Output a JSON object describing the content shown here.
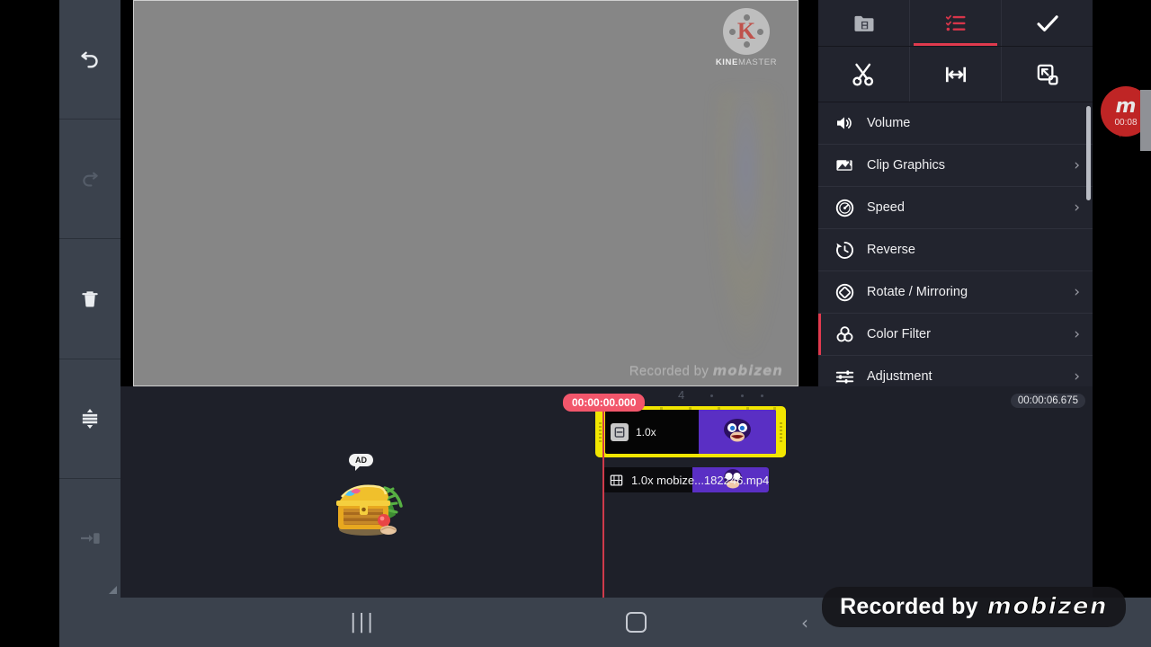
{
  "app": {
    "name": "KineMaster",
    "watermark_text_bold": "KINE",
    "watermark_text_light": "MASTER",
    "watermark_letter": "K"
  },
  "left_rail": {
    "items": [
      {
        "name": "undo",
        "icon": "undo-icon",
        "enabled": true
      },
      {
        "name": "redo",
        "icon": "redo-icon",
        "enabled": false
      },
      {
        "name": "delete",
        "icon": "trash-icon",
        "enabled": true
      },
      {
        "name": "expand-timeline",
        "icon": "expand-timeline-icon",
        "enabled": true
      },
      {
        "name": "jump-to-end",
        "icon": "jump-to-end-icon",
        "enabled": false
      }
    ]
  },
  "preview": {
    "recorded_by_prefix": "Recorded by",
    "recorded_by_brand": "mobizen"
  },
  "right_panel": {
    "tabs": [
      {
        "label": "",
        "icon": "media-browser-icon",
        "active": false
      },
      {
        "label": "",
        "icon": "clip-options-icon",
        "active": true
      },
      {
        "label": "",
        "icon": "check-icon",
        "active": false
      }
    ],
    "tools": [
      {
        "label": "",
        "icon": "scissors-icon"
      },
      {
        "label": "",
        "icon": "trim-split-icon"
      },
      {
        "label": "",
        "icon": "duplicate-icon"
      }
    ],
    "menu": [
      {
        "label": "Volume",
        "icon": "volume-icon",
        "chevron": false,
        "selected": false
      },
      {
        "label": "Clip Graphics",
        "icon": "clip-graphics-icon",
        "chevron": true,
        "selected": false
      },
      {
        "label": "Speed",
        "icon": "speed-icon",
        "chevron": true,
        "selected": false
      },
      {
        "label": "Reverse",
        "icon": "reverse-icon",
        "chevron": false,
        "selected": false
      },
      {
        "label": "Rotate / Mirroring",
        "icon": "rotate-mirror-icon",
        "chevron": true,
        "selected": false
      },
      {
        "label": "Color Filter",
        "icon": "color-filter-icon",
        "chevron": true,
        "selected": true
      },
      {
        "label": "Adjustment",
        "icon": "adjustment-icon",
        "chevron": true,
        "selected": false
      }
    ]
  },
  "recorder_bubble": {
    "brand_letter": "m",
    "timer": "00:08"
  },
  "timeline": {
    "playhead_time": "00:00:00.000",
    "total_time": "00:00:06.675",
    "ruler_label": "4",
    "selected_clip": {
      "speed": "1.0x",
      "icon": "layer-clip-icon"
    },
    "secondary_clip": {
      "label": "1.0x mobize...182246.mp4",
      "icon": "film-strip-icon"
    },
    "ad": {
      "badge": "AD",
      "icon": "treasure-chest-icon"
    }
  },
  "navbar": {
    "recents_glyph": "|||",
    "home_label": "",
    "back_glyph": "‹"
  },
  "banner": {
    "prefix": "Recorded by",
    "brand": "mobizen"
  }
}
